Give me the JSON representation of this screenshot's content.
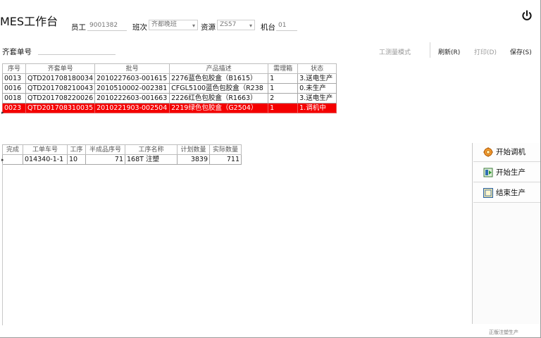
{
  "header": {
    "title": "MES工作台",
    "employee_label": "员工",
    "employee_value": "9001382",
    "shift_label": "班次",
    "shift_value": "齐都晚班",
    "resource_label": "资源",
    "resource_value": "ZS57",
    "machine_label": "机台",
    "machine_value": "01"
  },
  "toolbar": {
    "search_label": "齐套单号",
    "search_value": "",
    "btn_test": "工测量模式",
    "btn_refresh": "刷新(R)",
    "btn_print": "打印(D)",
    "btn_save": "保存(S)"
  },
  "order_table": {
    "columns": [
      "序号",
      "齐套单号",
      "批号",
      "产品描述",
      "需理箱",
      "状态"
    ],
    "rows": [
      [
        "0013",
        "QTD201708180034",
        "2010227603-001615",
        "2276蓝色包胶盒（B1615）",
        "1",
        "3.送电生产"
      ],
      [
        "0016",
        "QTD201708210043",
        "2010510002-002381",
        "CFGL5100蓝色包胶盒（R238",
        "1",
        "0.未生产"
      ],
      [
        "0018",
        "QTD201708220026",
        "2010222603-001663",
        "2226红色包胶盒（R1663）",
        "2",
        "3.送电生产"
      ],
      [
        "0023",
        "QTD201708310035",
        "2010221903-002504",
        "2219绿色包胶盒（G2504）",
        "1",
        "1.调机中"
      ]
    ],
    "selected_row": 3
  },
  "process_table": {
    "columns": [
      "完成",
      "工单车号",
      "工序",
      "半成品序号",
      "工序名称",
      "计划数量",
      "实际数量"
    ],
    "rows": [
      [
        "",
        "014340-1-1",
        "10",
        "71",
        "168T 注塑",
        "3839",
        "711"
      ]
    ]
  },
  "actions": {
    "start_tuning": "开始调机",
    "start_production": "开始生产",
    "end_production": "结束生产"
  },
  "status": {
    "footer": "正版注塑生产"
  },
  "colors": {
    "selected_row_bg": "#f40000",
    "selected_row_fg": "#ffffff"
  }
}
